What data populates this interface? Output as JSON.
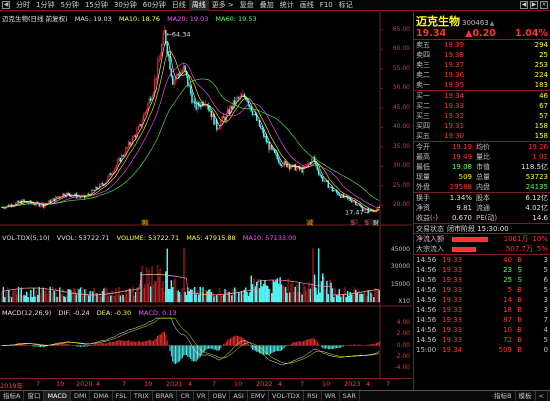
{
  "toolbar": {
    "timeframes": [
      "分时",
      "1分钟",
      "5分钟",
      "15分钟",
      "30分钟",
      "60分钟",
      "日线",
      "周线",
      "更多 >",
      "复盘",
      "叠加",
      "统计",
      "画线",
      "F10",
      "标记"
    ],
    "active_timeframe": "周线"
  },
  "main_chart": {
    "stock_label": "迈克生物(日线 前复权)",
    "ma5": "MA5: 19.03",
    "ma10": "MA10: 18.76",
    "ma20": "MA20: 19.03",
    "ma60": "MA60: 19.53",
    "y_ticks": [
      "65.00",
      "60.00",
      "55.00",
      "50.00",
      "45.00",
      "40.00",
      "35.00",
      "30.00",
      "25.00",
      "20.00"
    ],
    "high_marker": "64.34",
    "low_marker": "17.47",
    "event_tags": [
      "融",
      "减",
      "S",
      "S",
      "S"
    ],
    "bottom_tag": "财"
  },
  "volume_chart": {
    "legend_name": "VOL-TDX(5,10)",
    "vvol": "VVOL: 53722.71",
    "volume": "VOLUME: 53722.71",
    "mavol1": "MA5: 47915.88",
    "mavol2": "MA10: 57133.00",
    "y_ticks": [
      "45000",
      "30000",
      "15000"
    ],
    "unit": "X10"
  },
  "macd_chart": {
    "legend_name": "MACD(12,26,9)",
    "dif": "DIF: -0.24",
    "dea": "DEA: -0.30",
    "macd": "MACD: 0.13",
    "y_ticks": [
      "4.00",
      "2.00",
      "0.00",
      "-2.00",
      "-4.00"
    ]
  },
  "x_axis": {
    "labels": [
      "2019年",
      "7",
      "10",
      "2020",
      "4",
      "7",
      "10",
      "2021",
      "4",
      "7",
      "10",
      "2022",
      "4",
      "7",
      "10",
      "2023",
      "4",
      "7"
    ]
  },
  "bottom_tabs": {
    "tabs": [
      "指标A",
      "窗口",
      "MACD",
      "DMI",
      "DMA",
      "FSL",
      "TRIX",
      "BRAR",
      "CR",
      "VR",
      "OBV",
      "ASI",
      "EMV",
      "VOL-TDX",
      "RSI",
      "WR",
      "SAR"
    ],
    "active_tab": "MACD",
    "right_tabs": [
      "指标B",
      "模板",
      "<"
    ]
  },
  "quote": {
    "name": "迈克生物",
    "code": "300463",
    "price": "19.34",
    "change": "▲0.20",
    "change_pct": "1.04%",
    "asks": [
      {
        "label": "卖五",
        "price": "19.39",
        "vol": "294"
      },
      {
        "label": "卖四",
        "price": "19.38",
        "vol": "25"
      },
      {
        "label": "卖三",
        "price": "19.37",
        "vol": "253"
      },
      {
        "label": "卖二",
        "price": "19.36",
        "vol": "224"
      },
      {
        "label": "卖一",
        "price": "19.35",
        "vol": "183"
      }
    ],
    "bids": [
      {
        "label": "买一",
        "price": "19.34",
        "vol": "46"
      },
      {
        "label": "买二",
        "price": "19.33",
        "vol": "67"
      },
      {
        "label": "买三",
        "price": "19.32",
        "vol": "57"
      },
      {
        "label": "买四",
        "price": "19.31",
        "vol": "158"
      },
      {
        "label": "买五",
        "price": "19.30",
        "vol": "158"
      }
    ],
    "stats": [
      {
        "l1": "今开",
        "v1": "19.19",
        "c1": "#ff3333",
        "l2": "均价",
        "v2": "19.26",
        "c2": "#ff3333"
      },
      {
        "l1": "最高",
        "v1": "19.49",
        "c1": "#ff3333",
        "l2": "量比",
        "v2": "1.01",
        "c2": "#ff3333"
      },
      {
        "l1": "最低",
        "v1": "19.08",
        "c1": "#55ff55",
        "l2": "市值",
        "v2": "118.5亿",
        "c2": "#e0e0e0"
      },
      {
        "l1": "现量",
        "v1": "509",
        "c1": "#ffff00",
        "l2": "总量",
        "v2": "53723",
        "c2": "#ffff00"
      },
      {
        "l1": "外盘",
        "v1": "29588",
        "c1": "#ff3333",
        "l2": "内盘",
        "v2": "24135",
        "c2": "#55ff55"
      }
    ],
    "stats2": [
      {
        "l1": "换手",
        "v1": "1.34%",
        "c1": "#e0e0e0",
        "l2": "股本",
        "v2": "6.12亿",
        "c2": "#e0e0e0"
      },
      {
        "l1": "净资",
        "v1": "9.81",
        "c1": "#e0e0e0",
        "l2": "流通",
        "v2": "4.02亿",
        "c2": "#e0e0e0"
      },
      {
        "l1": "收益(-)",
        "v1": "0.670",
        "c1": "#e0e0e0",
        "l2": "PE(动)",
        "v2": "14.6",
        "c2": "#e0e0e0"
      }
    ],
    "status_label": "交易状态",
    "status_value": "闭市阶段 15:30:00",
    "flows": [
      {
        "label": "净流入额",
        "value": "1061万",
        "pct": "10%",
        "bar": 0.6
      },
      {
        "label": "大宗流入",
        "value": "507.7万",
        "pct": "5%",
        "bar": 0.4
      }
    ],
    "ticks": [
      {
        "t": "14:56",
        "p": "19.33",
        "v": "40",
        "d": "B",
        "dc": "#ff3333",
        "n": "3"
      },
      {
        "t": "14:56",
        "p": "19.33",
        "v": "23",
        "d": "S",
        "dc": "#55ff55",
        "n": "5"
      },
      {
        "t": "14:56",
        "p": "19.33",
        "v": "25",
        "d": "S",
        "dc": "#55ff55",
        "n": "6"
      },
      {
        "t": "14:56",
        "p": "19.33",
        "v": "5",
        "d": "B",
        "dc": "#ff3333",
        "n": "5"
      },
      {
        "t": "14:56",
        "p": "19.33",
        "v": "14",
        "d": "B",
        "dc": "#ff3333",
        "n": "3"
      },
      {
        "t": "14:56",
        "p": "19.33",
        "v": "18",
        "d": "B",
        "dc": "#ff3333",
        "n": "3"
      },
      {
        "t": "14:56",
        "p": "19.33",
        "v": "87",
        "d": "B",
        "dc": "#ff3333",
        "n": "7"
      },
      {
        "t": "14:56",
        "p": "19.33",
        "v": "10",
        "d": "B",
        "dc": "#ff3333",
        "n": "4"
      },
      {
        "t": "14:56",
        "p": "19.33",
        "v": "72",
        "d": "B",
        "dc": "#ff3333",
        "n": "5"
      },
      {
        "t": "15:00",
        "p": "19.34",
        "v": "509",
        "d": "B",
        "dc": "#ff3333",
        "n": "0"
      }
    ]
  },
  "colors": {
    "up": "#ff3333",
    "down": "#55ffff",
    "ma5": "#ffffff",
    "ma10": "#ffff00",
    "ma20": "#ff55ff",
    "ma60": "#55ff55",
    "grid": "#7a1f1f"
  }
}
